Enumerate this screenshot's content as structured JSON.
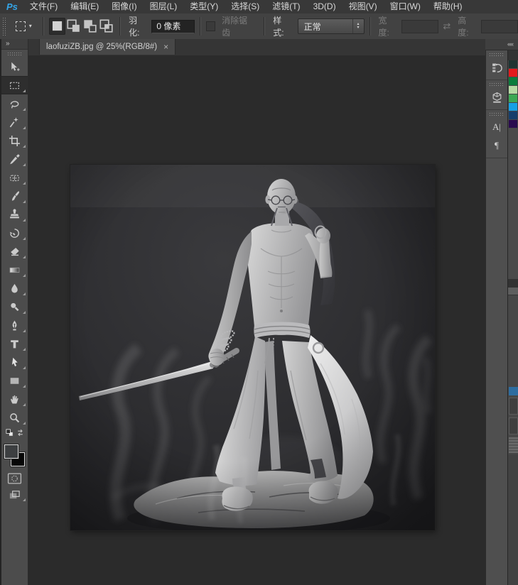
{
  "app": {
    "logo_text": "Ps",
    "logo_color": "#34a5e8"
  },
  "menu": {
    "items": [
      "文件(F)",
      "编辑(E)",
      "图像(I)",
      "图层(L)",
      "类型(Y)",
      "选择(S)",
      "滤镜(T)",
      "3D(D)",
      "视图(V)",
      "窗口(W)",
      "帮助(H)"
    ]
  },
  "options_bar": {
    "tool_preset_caret": "▾",
    "feather_label": "羽化:",
    "feather_value": "0 像素",
    "antialias_label": "消除锯齿",
    "style_label": "样式:",
    "style_value": "正常",
    "spinner_up": "▴",
    "spinner_down": "▾",
    "width_label": "宽度:",
    "width_value": "",
    "swap_glyph": "⇄",
    "height_label": "高度:",
    "height_value": ""
  },
  "document": {
    "tab_title": "laofuziZB.jpg @ 25%(RGB/8#)",
    "filename": "laofuziZB.jpg",
    "zoom": "25%",
    "color_mode": "RGB/8#",
    "close_glyph": "×"
  },
  "tools": {
    "selected": "rectangular-marquee",
    "items": [
      "move",
      "rectangular-marquee",
      "lasso",
      "magic-wand",
      "crop",
      "eyedropper",
      "healing-brush",
      "brush",
      "clone-stamp",
      "history-brush",
      "eraser",
      "gradient",
      "blur",
      "dodge",
      "pen",
      "type",
      "path-selection",
      "rectangle",
      "hand",
      "zoom"
    ]
  },
  "panels": {
    "tools_collapse_glyph": "»",
    "right_collapse_glyph": "««",
    "right_icons": [
      "history",
      "3d",
      "character",
      "paragraph"
    ],
    "character_glyph": "A|",
    "paragraph_glyph": "¶"
  },
  "swatches": {
    "colors": [
      "#1e3432",
      "#e2191c",
      "#0b7c3c",
      "#b7d9a4",
      "#3da853",
      "#17a0e4",
      "#173e6b",
      "#2a0b4e"
    ]
  },
  "layers_sliver": {
    "accent": "#2e6da0"
  },
  "artwork": {
    "description": "grayscale ZBrush-style sculpture render: bald elderly man with round glasses and long thin mustache, shirtless muscular torso, flowing hakama pants, katana in right hand, scabbard over left shoulder, smoke wisps, rocky base"
  },
  "ui_colors": {
    "menu_bg": "#383838",
    "options_bg": "#424242",
    "panel_bg": "#4c4c4c",
    "pasteboard": "#2b2b2b",
    "image_bg": "#2c2c2e",
    "tab_bg": "#474747",
    "foreground_swatch": "#3d3f41",
    "background_swatch": "#070707"
  }
}
